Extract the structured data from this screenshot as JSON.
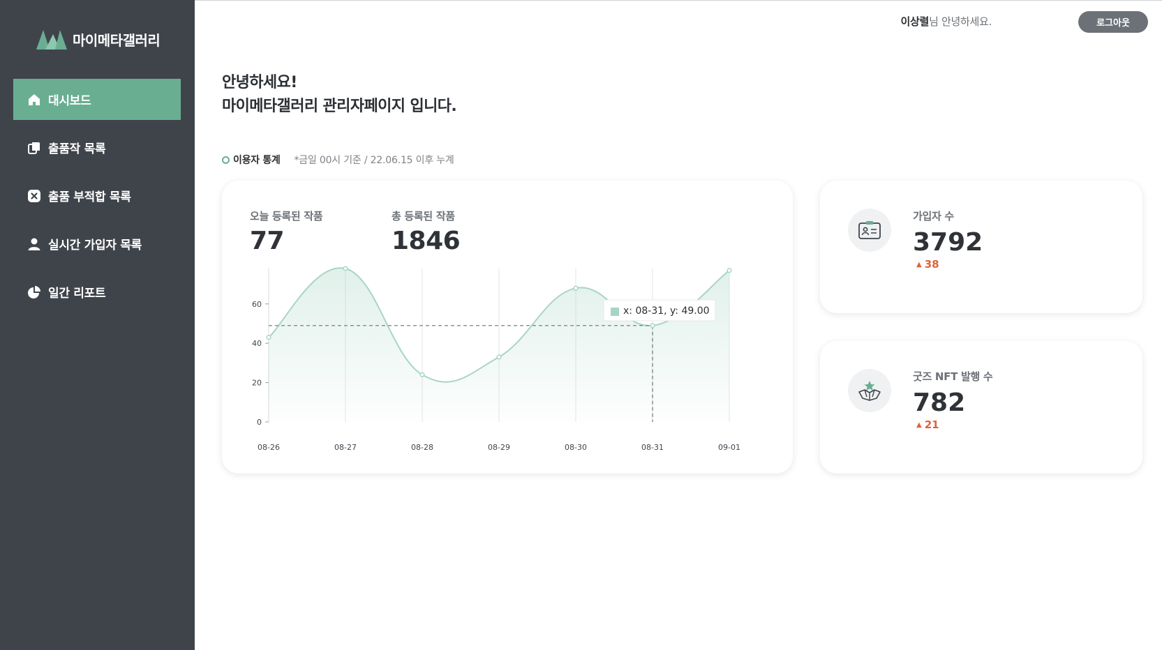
{
  "brand": {
    "name": "마이메타갤러리"
  },
  "sidebar": {
    "items": [
      {
        "label": "대시보드",
        "icon": "home-icon",
        "active": true
      },
      {
        "label": "출품작 목록",
        "icon": "copy-icon",
        "active": false
      },
      {
        "label": "출품 부적합 목록",
        "icon": "close-icon",
        "active": false
      },
      {
        "label": "실시간 가입자 목록",
        "icon": "user-icon",
        "active": false
      },
      {
        "label": "일간 리포트",
        "icon": "pie-icon",
        "active": false
      }
    ]
  },
  "header": {
    "user_name": "이상렬",
    "greeting_suffix": "님 안녕하세요.",
    "logout_label": "로그아웃"
  },
  "welcome": {
    "line1": "안녕하세요!",
    "line2": "마이메타갤러리 관리자페이지 입니다."
  },
  "section": {
    "title": "이용자 통계",
    "note": "*금일 00시 기준 / 22.06.15 이후 누계"
  },
  "main_card": {
    "today_label": "오늘 등록된 작품",
    "today_value": "77",
    "total_label": "총 등록된 작품",
    "total_value": "1846"
  },
  "chart_data": {
    "type": "area",
    "categories": [
      "08-26",
      "08-27",
      "08-28",
      "08-29",
      "08-30",
      "08-31",
      "09-01"
    ],
    "values": [
      43,
      78,
      24,
      33,
      68,
      49,
      77
    ],
    "yticks": [
      0,
      20,
      40,
      60
    ],
    "ylim": [
      0,
      78
    ],
    "tooltip": "x: 08-31, y: 49.00",
    "highlight_index": 5,
    "color": "#a8d5c3"
  },
  "cards": [
    {
      "label": "가입자 수",
      "value": "3792",
      "delta": "38",
      "icon": "id-card-icon"
    },
    {
      "label": "굿즈 NFT 발행 수",
      "value": "782",
      "delta": "21",
      "icon": "star-box-icon"
    }
  ],
  "colors": {
    "accent": "#6aae92",
    "sidebar": "#3f444b",
    "delta": "#e0623a"
  }
}
